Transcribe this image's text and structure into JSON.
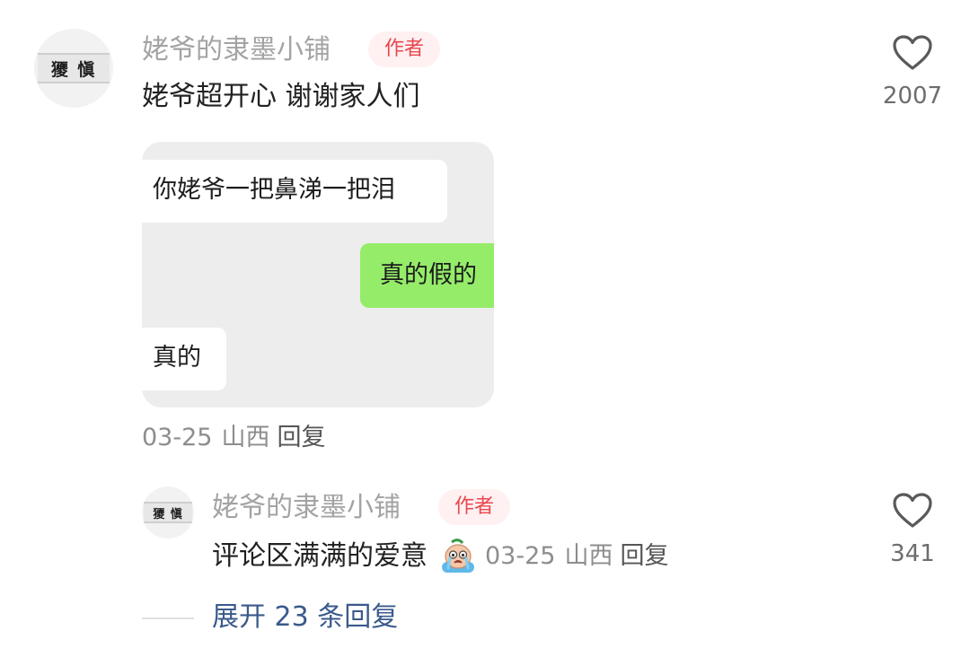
{
  "comment": {
    "avatar_text": "獿 愼",
    "username": "姥爷的隶墨小铺",
    "badge": "作者",
    "text": "姥爷超开心 谢谢家人们",
    "image": {
      "bubbles": [
        {
          "side": "left",
          "text": "你姥爷一把鼻涕一把泪"
        },
        {
          "side": "right",
          "text": "真的假的"
        },
        {
          "side": "left",
          "text": "真的"
        }
      ]
    },
    "date": "03-25",
    "location": "山西",
    "reply_label": "回复",
    "like_icon": "heart-outline-icon",
    "likes": "2007"
  },
  "reply": {
    "avatar_text": "獿 愼",
    "username": "姥爷的隶墨小铺",
    "badge": "作者",
    "text": "评论区满满的爱意",
    "emoji_icon": "crying-face-emoji-icon",
    "date": "03-25",
    "location": "山西",
    "reply_label": "回复",
    "like_icon": "heart-outline-icon",
    "likes": "341"
  },
  "expand": {
    "label": "展开 23 条回复"
  },
  "colors": {
    "badge_text": "#e8484f",
    "badge_bg": "#fff0f1",
    "expand_link": "#3a5a8c",
    "chat_green": "#95ec69",
    "chat_bg": "#ededed"
  }
}
